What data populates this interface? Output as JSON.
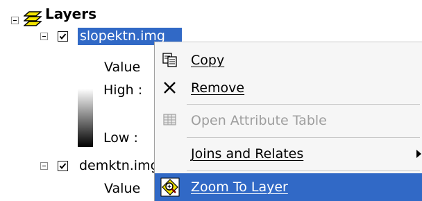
{
  "toc": {
    "root_label": "Layers",
    "layers": [
      {
        "name": "slopektn.img",
        "checked": true,
        "selected": true,
        "legend_heading": "Value",
        "high_label": "High : ",
        "low_label": "Low : "
      },
      {
        "name": "demktn.img",
        "checked": true,
        "selected": false,
        "legend_heading": "Value"
      }
    ]
  },
  "context_menu": {
    "items": [
      {
        "label": "Copy",
        "icon": "copy-icon",
        "enabled": true
      },
      {
        "label": "Remove",
        "icon": "remove-icon",
        "enabled": true
      },
      {
        "label": "Open Attribute Table",
        "icon": "table-icon",
        "enabled": false
      },
      {
        "label": "Joins and Relates",
        "icon": "",
        "enabled": true,
        "submenu": true
      },
      {
        "label": "Zoom To Layer",
        "icon": "zoom-to-layer-icon",
        "enabled": true,
        "highlighted": true
      }
    ]
  },
  "colors": {
    "selection": "#3169c6",
    "menu_background": "#f6f6f6",
    "disabled_text": "#9e9e9e"
  }
}
